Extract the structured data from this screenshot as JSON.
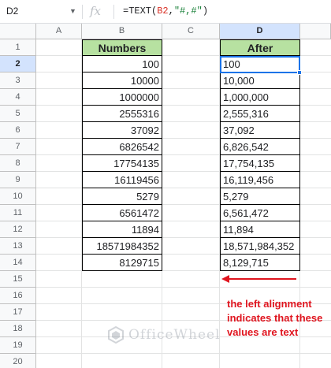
{
  "formula_bar": {
    "name_box": "D2",
    "fx_label": "fx",
    "formula_prefix": "=TEXT(",
    "formula_ref": "B2",
    "formula_sep": ",",
    "formula_str": "\"#,#\"",
    "formula_suffix": ")"
  },
  "columns": [
    "A",
    "B",
    "C",
    "D"
  ],
  "rows": [
    "1",
    "2",
    "3",
    "4",
    "5",
    "6",
    "7",
    "8",
    "9",
    "10",
    "11",
    "12",
    "13",
    "14",
    "15",
    "16",
    "17",
    "18",
    "19",
    "20"
  ],
  "selected_cell": {
    "column": "D",
    "row": "2"
  },
  "table": {
    "numbers_header": "Numbers",
    "after_header": "After",
    "numbers": [
      "100",
      "10000",
      "1000000",
      "2555316",
      "37092",
      "6826542",
      "17754135",
      "16119456",
      "5279",
      "6561472",
      "11894",
      "18571984352",
      "8129715"
    ],
    "after": [
      "100",
      "10,000",
      "1,000,000",
      "2,555,316",
      "37,092",
      "6,826,542",
      "17,754,135",
      "16,119,456",
      "5,279",
      "6,561,472",
      "11,894",
      "18,571,984,352",
      "8,129,715"
    ]
  },
  "annotation": {
    "text": "the left alignment indicates that these values are text",
    "color": "#e0151f"
  },
  "watermark": {
    "text": "OfficeWheel"
  },
  "colors": {
    "header_fill": "#b7e1a1",
    "selection": "#1a73e8"
  }
}
